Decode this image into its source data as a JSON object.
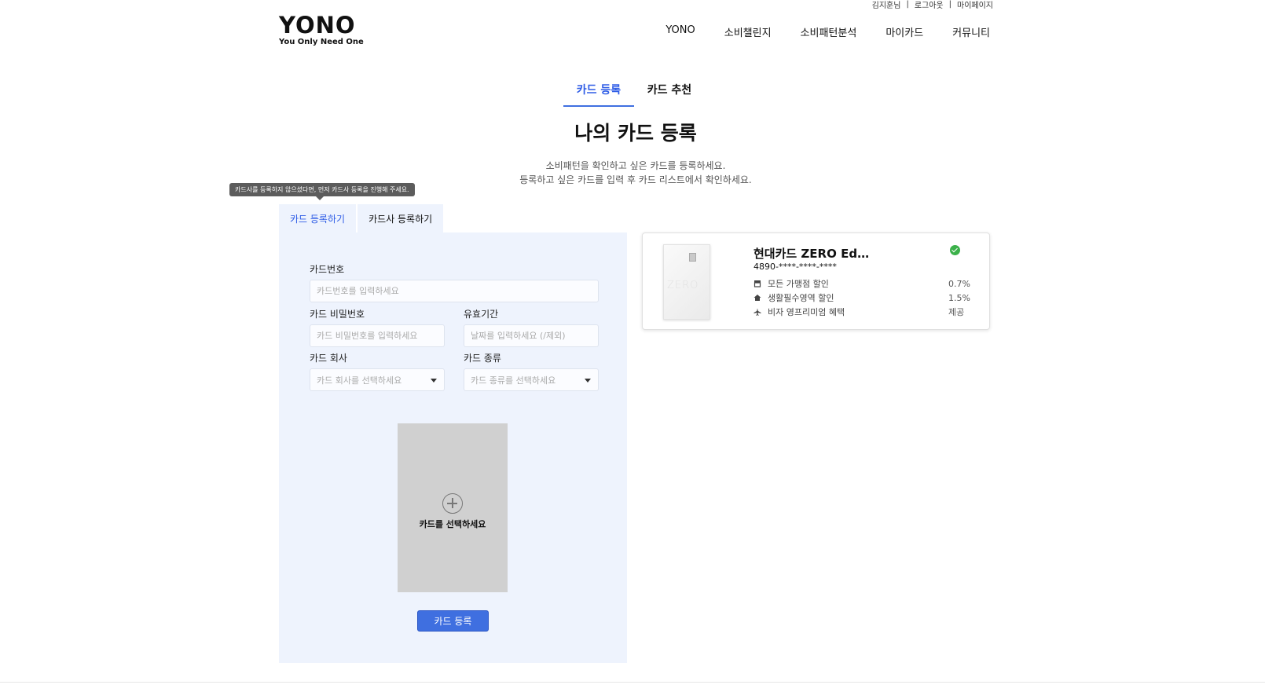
{
  "util": {
    "user": "김지훈님",
    "logout": "로그아웃",
    "mypage": "마이페이지"
  },
  "logo": {
    "main": "YONO",
    "sub": "You Only Need One"
  },
  "nav": {
    "items": [
      "YONO",
      "소비챌린지",
      "소비패턴분석",
      "마이카드",
      "커뮤니티"
    ]
  },
  "tabs": {
    "register": "카드 등록",
    "recommend": "카드 추천"
  },
  "page": {
    "title": "나의 카드 등록",
    "desc1": "소비패턴을 확인하고 싶은 카드를 등록하세요.",
    "desc2": "등록하고 싶은 카드를 입력 후 카드 리스트에서 확인하세요."
  },
  "tooltip": "카드사를 등록하지 않으셨다면, 먼저 카드사 등록을 진행해 주세요.",
  "form_tabs": {
    "card": "카드 등록하기",
    "company": "카드사 등록하기"
  },
  "form": {
    "card_number_label": "카드번호",
    "card_number_placeholder": "카드번호를 입력하세요",
    "password_label": "카드 비밀번호",
    "password_placeholder": "카드 비밀번호를 입력하세요",
    "expiry_label": "유효기간",
    "expiry_placeholder": "날짜를 입력하세요 (/제외)",
    "company_label": "카드 회사",
    "company_placeholder": "카드 회사를 선택하세요",
    "type_label": "카드 종류",
    "type_placeholder": "카드 종류를 선택하세요",
    "upload_text": "카드를 선택하세요",
    "submit": "카드 등록"
  },
  "card": {
    "name": "현대카드 ZERO Edit…",
    "number": "4890-****-****-****",
    "thumb_text": "ZERO",
    "benefits": [
      {
        "icon": "store-icon",
        "label": "모든 가맹점 할인",
        "value": "0.7%"
      },
      {
        "icon": "home-icon",
        "label": "생활필수영역 할인",
        "value": "1.5%"
      },
      {
        "icon": "plane-icon",
        "label": "비자 영프리미엄 혜택",
        "value": "제공"
      }
    ]
  },
  "colors": {
    "accent": "#3f6fe0",
    "panel_bg": "#eef3fd",
    "check": "#3bb14a"
  }
}
